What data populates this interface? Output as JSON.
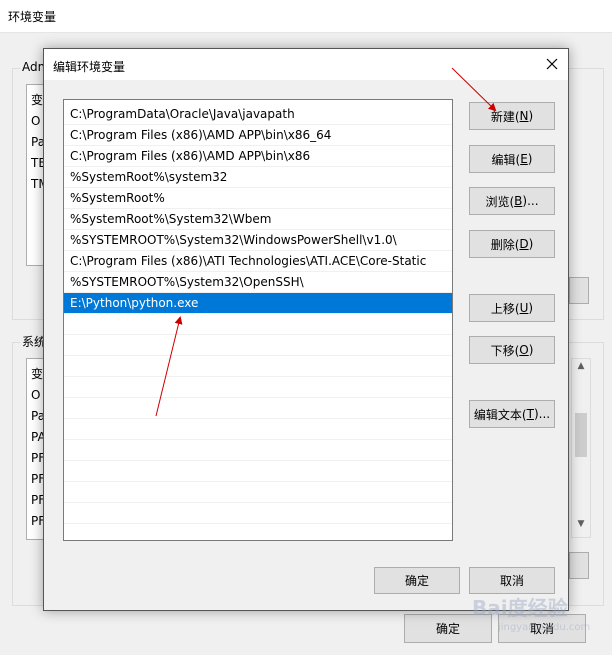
{
  "parent_window": {
    "title": "环境变量",
    "user_group_label": "Adm",
    "user_vars": [
      "变",
      "O",
      "Pa",
      "TE",
      "TM"
    ],
    "system_group_label": "系统",
    "system_vars": [
      "变",
      "O",
      "Pa",
      "PA",
      "PF",
      "PF",
      "PF",
      "PF"
    ],
    "ok_label": "确定",
    "cancel_label": "取消"
  },
  "dialog": {
    "title": "编辑环境变量",
    "paths": [
      "C:\\ProgramData\\Oracle\\Java\\javapath",
      "C:\\Program Files (x86)\\AMD APP\\bin\\x86_64",
      "C:\\Program Files (x86)\\AMD APP\\bin\\x86",
      "%SystemRoot%\\system32",
      "%SystemRoot%",
      "%SystemRoot%\\System32\\Wbem",
      "%SYSTEMROOT%\\System32\\WindowsPowerShell\\v1.0\\",
      "C:\\Program Files (x86)\\ATI Technologies\\ATI.ACE\\Core-Static",
      "%SYSTEMROOT%\\System32\\OpenSSH\\",
      "E:\\Python\\python.exe"
    ],
    "selected_index": 9,
    "buttons": {
      "new": {
        "text": "新建(",
        "key": "N",
        "end": ")"
      },
      "edit": {
        "text": "编辑(",
        "key": "E",
        "end": ")"
      },
      "browse": {
        "text": "浏览(",
        "key": "B",
        "end": ")..."
      },
      "delete": {
        "text": "删除(",
        "key": "D",
        "end": ")"
      },
      "move_up": {
        "text": "上移(",
        "key": "U",
        "end": ")"
      },
      "move_down": {
        "text": "下移(",
        "key": "O",
        "end": ")"
      },
      "edit_text": {
        "text": "编辑文本(",
        "key": "T",
        "end": ")..."
      }
    },
    "ok_label": "确定",
    "cancel_label": "取消"
  },
  "watermark": {
    "text": "Bai度经验",
    "sub": "jingyan.baidu.com"
  },
  "colors": {
    "selection": "#0078d7",
    "arrow": "#cc0000"
  }
}
